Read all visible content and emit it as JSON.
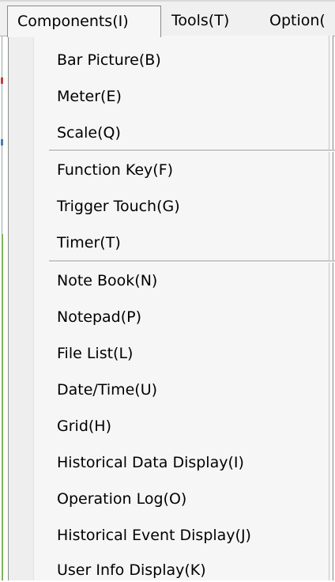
{
  "menubar": {
    "items": [
      {
        "label": "Components(I)",
        "state": "open"
      },
      {
        "label": "Tools(T)"
      },
      {
        "label": "Option("
      }
    ]
  },
  "dropdown": {
    "groups": [
      {
        "items": [
          {
            "label": "Bar Picture(B)"
          },
          {
            "label": "Meter(E)"
          },
          {
            "label": "Scale(Q)"
          }
        ]
      },
      {
        "items": [
          {
            "label": "Function Key(F)"
          },
          {
            "label": "Trigger Touch(G)"
          },
          {
            "label": "Timer(T)"
          }
        ]
      },
      {
        "items": [
          {
            "label": "Note Book(N)"
          },
          {
            "label": "Notepad(P)"
          },
          {
            "label": "File List(L)"
          },
          {
            "label": "Date/Time(U)"
          },
          {
            "label": "Grid(H)"
          },
          {
            "label": "Historical Data Display(I)"
          },
          {
            "label": "Operation Log(O)"
          },
          {
            "label": "Historical Event Display(J)"
          },
          {
            "label": "User Info Display(K)"
          }
        ]
      }
    ]
  }
}
